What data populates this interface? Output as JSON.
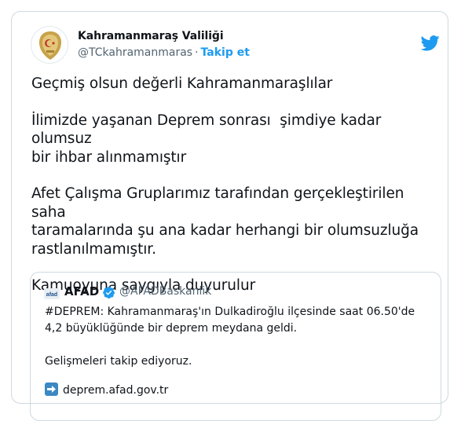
{
  "tweet": {
    "author": {
      "display_name": "Kahramanmaraş Valiliği",
      "handle": "@TCkahramanmaras",
      "follow_label": "Takip et"
    },
    "separator": "·",
    "paragraphs": [
      "Geçmiş olsun değerli Kahramanmaraşlılar",
      "İlimizde yaşanan Deprem sonrası  şimdiye kadar olumsuz\nbir ihbar alınmamıştır",
      "Afet Çalışma Gruplarımız tarafından gerçekleştirilen saha\ntaramalarında şu ana kadar herhangi bir olumsuzluğa\nrastlanılmamıştır.",
      "Kamuoyuna saygıyla duyurulur"
    ]
  },
  "quoted": {
    "logo_text": "afad",
    "display_name": "AFAD",
    "handle": "@AFADBaskanlik",
    "paragraphs": [
      "#DEPREM: Kahramanmaraş'ın Dulkadiroğlu ilçesinde saat 06.50'de 4,2 büyüklüğünde bir deprem meydana geldi.",
      "Gelişmeleri takip ediyoruz."
    ],
    "link": "deprem.afad.gov.tr"
  },
  "icons": {
    "brand": "twitter-bird-icon",
    "verified": "verified-badge-icon",
    "link": "right-arrow-icon"
  },
  "colors": {
    "accent": "#1d9bf0",
    "secondary_text": "#536471",
    "border": "#cfd9de",
    "avatar_emblem": "#c8a24a",
    "link_arrow": "#3b88c3"
  }
}
